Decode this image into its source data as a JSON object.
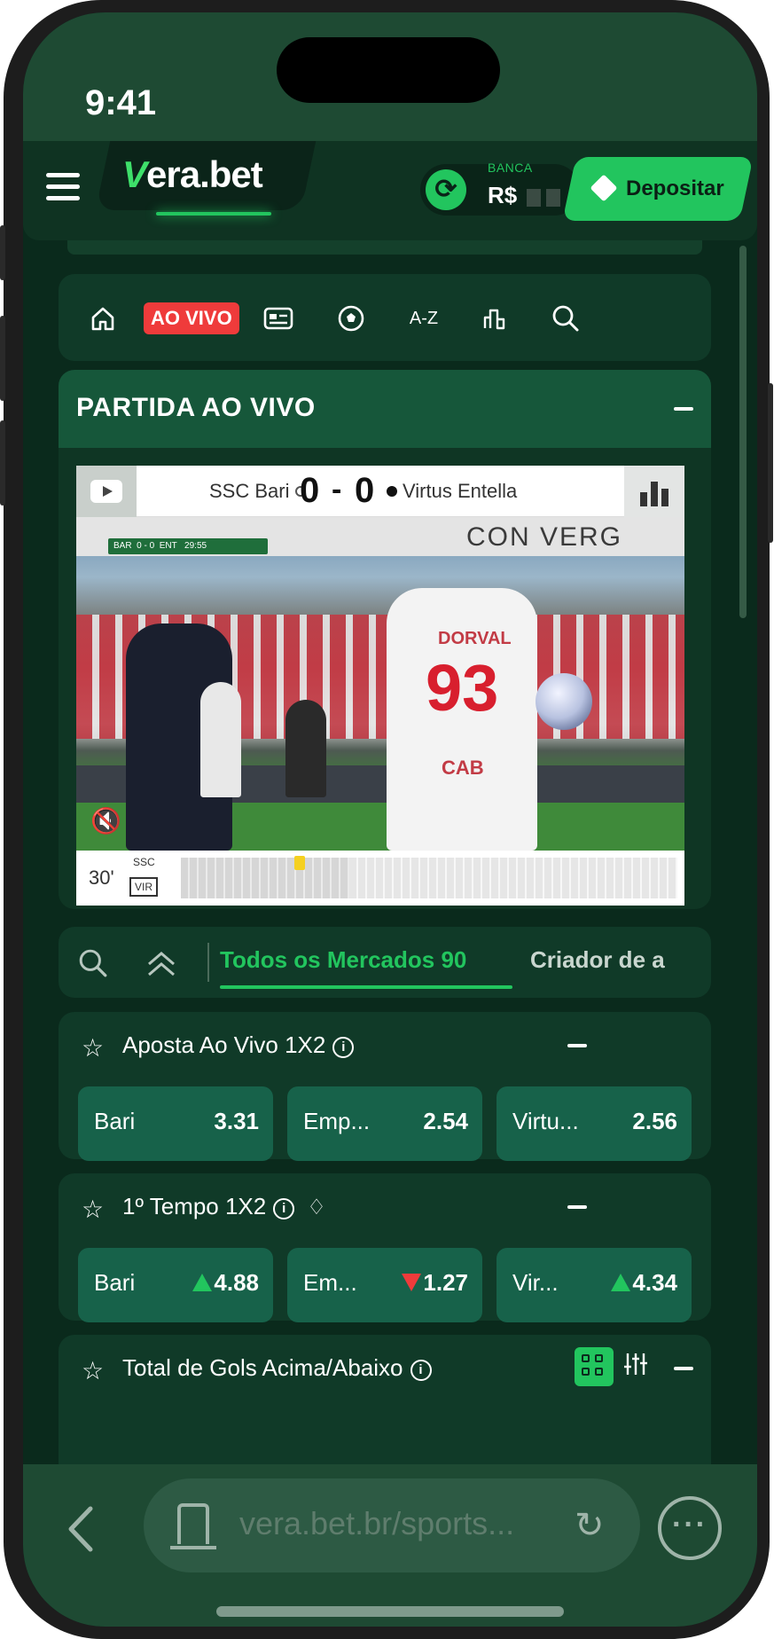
{
  "status_bar": {
    "time": "9:41"
  },
  "header": {
    "logo_v": "V",
    "logo_rest": "era.bet",
    "balance_label": "BANCA",
    "currency": "R$",
    "deposit_label": "Depositar"
  },
  "nav": {
    "live_label": "AO VIVO",
    "az_label": "A-Z"
  },
  "live_match": {
    "section_title": "PARTIDA AO VIVO",
    "home_team": "SSC Bari",
    "away_team": "Virtus Entella",
    "home_score": "0",
    "score_separator": "-",
    "away_score": "0",
    "minute": "30'",
    "timeline_home": "SSC",
    "timeline_away": "VIR",
    "overlay_home": "BAR",
    "overlay_score": "0 - 0",
    "overlay_away": "ENT",
    "overlay_clock": "29:55",
    "banner_text": "CON VERG",
    "player_name": "DORVAL",
    "player_number": "93",
    "sponsor": "CAB"
  },
  "markets_bar": {
    "active_tab": "Todos os Mercados 90",
    "next_tab": "Criador de a"
  },
  "markets": [
    {
      "title": "Aposta Ao Vivo 1X2",
      "odds": [
        {
          "name": "Bari",
          "value": "3.31"
        },
        {
          "name": "Emp...",
          "value": "2.54"
        },
        {
          "name": "Virtu...",
          "value": "2.56"
        }
      ]
    },
    {
      "title": "1º Tempo 1X2",
      "odds": [
        {
          "name": "Bari",
          "value": "4.88",
          "trend": "up"
        },
        {
          "name": "Em...",
          "value": "1.27",
          "trend": "down"
        },
        {
          "name": "Vir...",
          "value": "4.34",
          "trend": "up"
        }
      ]
    },
    {
      "title": "Total de Gols Acima/Abaixo"
    }
  ],
  "browser": {
    "url": "vera.bet.br/sports..."
  },
  "colors": {
    "accent": "#22c55e",
    "live_red": "#ef3b3b",
    "background": "#0a2a1c",
    "card": "#103a28",
    "odds_button": "#17624a"
  }
}
